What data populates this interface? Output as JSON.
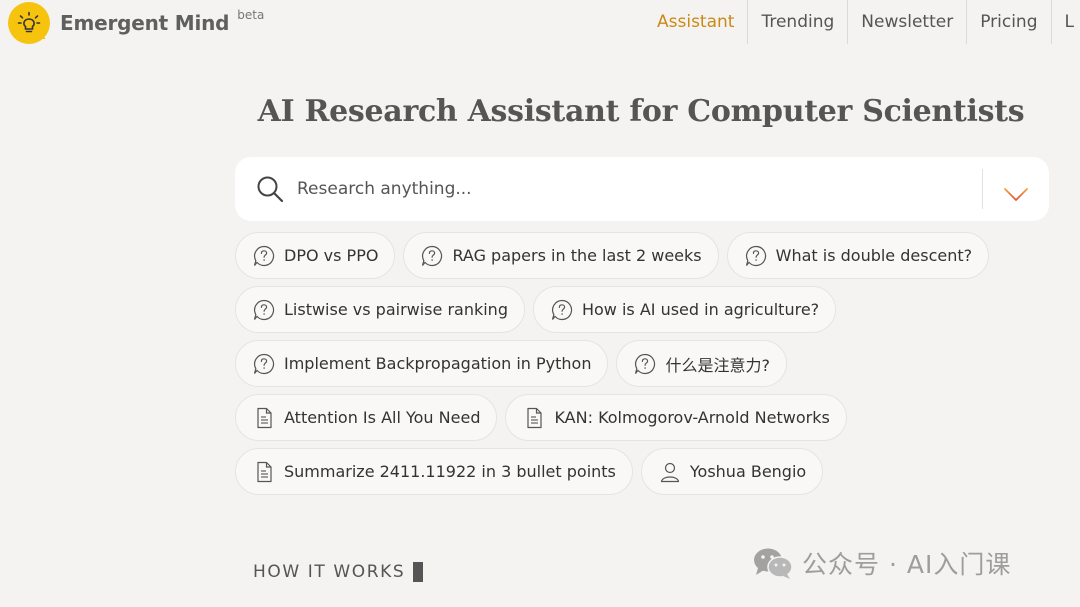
{
  "brand": {
    "name": "Emergent Mind",
    "badge": "beta"
  },
  "nav": {
    "items": [
      {
        "label": "Assistant",
        "active": true
      },
      {
        "label": "Trending"
      },
      {
        "label": "Newsletter"
      },
      {
        "label": "Pricing"
      },
      {
        "label": "L"
      }
    ]
  },
  "hero": {
    "title": "AI Research Assistant for Computer Scientists"
  },
  "search": {
    "placeholder": "Research anything..."
  },
  "suggestions": {
    "rows": [
      [
        {
          "label": "DPO vs PPO",
          "icon": "question-bubble-icon"
        },
        {
          "label": "RAG papers in the last 2 weeks",
          "icon": "question-bubble-icon"
        },
        {
          "label": "What is double descent?",
          "icon": "question-bubble-icon"
        }
      ],
      [
        {
          "label": "Listwise vs pairwise ranking",
          "icon": "question-bubble-icon"
        },
        {
          "label": "How is AI used in agriculture?",
          "icon": "question-bubble-icon"
        }
      ],
      [
        {
          "label": "Implement Backpropagation in Python",
          "icon": "question-bubble-icon"
        },
        {
          "label": "什么是注意力?",
          "icon": "question-bubble-icon"
        }
      ],
      [
        {
          "label": "Attention Is All You Need",
          "icon": "document-icon"
        },
        {
          "label": "KAN: Kolmogorov-Arnold Networks",
          "icon": "document-icon"
        }
      ],
      [
        {
          "label": "Summarize 2411.11922 in 3 bullet points",
          "icon": "document-icon"
        },
        {
          "label": "Yoshua Bengio",
          "icon": "person-icon"
        }
      ]
    ]
  },
  "how_it_works": {
    "title": "HOW IT WORKS"
  },
  "watermark": {
    "label": "公众号 · AI入门课"
  },
  "colors": {
    "background": "#f4f3f1",
    "accent": "#c98a17",
    "logo": "#f6c30f",
    "submit_arrow_top": "#f0a23a",
    "submit_arrow_bottom": "#e0553a"
  }
}
